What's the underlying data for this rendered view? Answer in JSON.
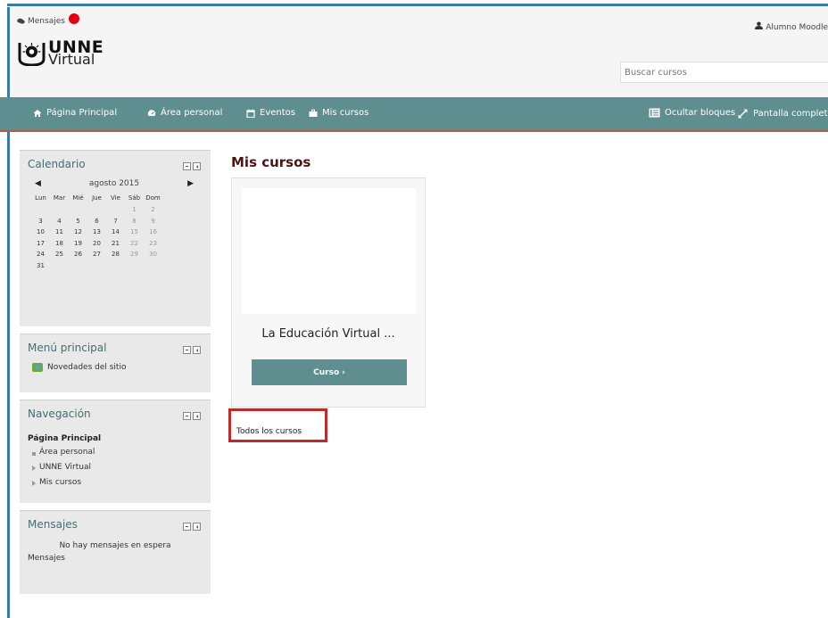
{
  "header": {
    "messages_label": "Mensajes",
    "user_name": "Alumno Moodle",
    "logo_line1": "UNNE",
    "logo_line2": "Virtual",
    "search_placeholder": "Buscar cursos"
  },
  "navbar": {
    "items": [
      {
        "label": "Página Principal",
        "icon": "home-icon"
      },
      {
        "label": "Área personal",
        "icon": "dashboard-icon"
      },
      {
        "label": "Eventos",
        "icon": "calendar-icon"
      },
      {
        "label": "Mis cursos",
        "icon": "briefcase-icon"
      }
    ],
    "right": [
      {
        "label": "Ocultar bloques",
        "icon": "hide-blocks-icon"
      },
      {
        "label": "Pantalla completa",
        "icon": "fullscreen-icon"
      }
    ]
  },
  "calendar": {
    "title": "Calendario",
    "month": "agosto 2015",
    "weekdays": [
      "Lun",
      "Mar",
      "Mié",
      "Jue",
      "Vie",
      "Sáb",
      "Dom"
    ],
    "weeks": [
      [
        "",
        "",
        "",
        "",
        "",
        "1",
        "2"
      ],
      [
        "3",
        "4",
        "5",
        "6",
        "7",
        "8",
        "9"
      ],
      [
        "10",
        "11",
        "12",
        "13",
        "14",
        "15",
        "16"
      ],
      [
        "17",
        "18",
        "19",
        "20",
        "21",
        "22",
        "23"
      ],
      [
        "24",
        "25",
        "26",
        "27",
        "28",
        "29",
        "30"
      ],
      [
        "31",
        "",
        "",
        "",
        "",
        "",
        ""
      ]
    ]
  },
  "main_menu": {
    "title": "Menú principal",
    "news_label": "Novedades del sitio"
  },
  "navigation": {
    "title": "Navegación",
    "root": "Página Principal",
    "items": [
      "Área personal",
      "UNNE Virtual",
      "Mis cursos"
    ]
  },
  "messages_block": {
    "title": "Mensajes",
    "empty": "No hay mensajes en espera",
    "link": "Mensajes"
  },
  "main": {
    "title": "Mis cursos",
    "course_name": "La Educación Virtual ...",
    "course_button": "Curso",
    "all_courses": "Todos los cursos"
  },
  "colors": {
    "accent": "#5e8e8f",
    "nav_border": "#a96145",
    "highlight": "#c22a2a",
    "title": "#4d1414",
    "block_title": "#3f6f72"
  }
}
